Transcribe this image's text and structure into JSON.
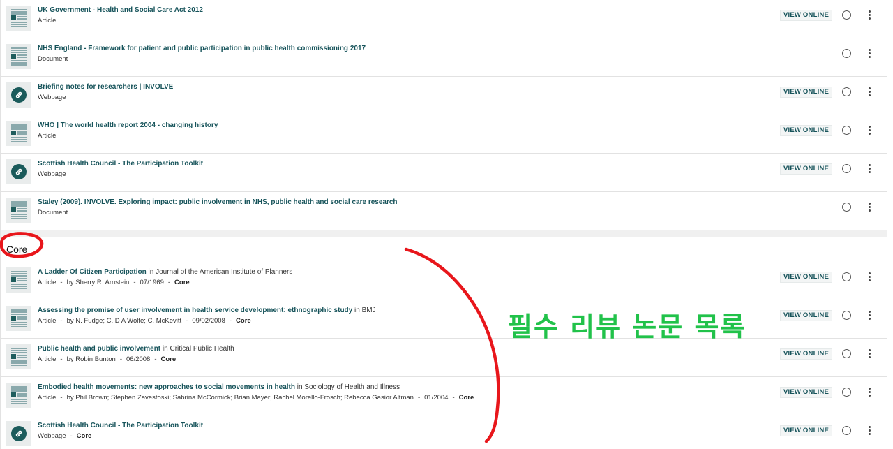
{
  "view_online_label": "VIEW ONLINE",
  "colors": {
    "title": "#16535a",
    "annotation_red": "#e8161b",
    "annotation_green": "#21c24a"
  },
  "top_items": [
    {
      "title": "UK Government - Health and Social Care Act 2012",
      "type": "Article",
      "icon": "document-icon",
      "view_online": true
    },
    {
      "title": "NHS England - Framework for patient and public participation in public health commissioning 2017",
      "type": "Document",
      "icon": "document-icon",
      "view_online": false
    },
    {
      "title": "Briefing notes for researchers | INVOLVE",
      "type": "Webpage",
      "icon": "link-icon",
      "view_online": true
    },
    {
      "title": "WHO | The world health report 2004 - changing history",
      "type": "Article",
      "icon": "document-icon",
      "view_online": true
    },
    {
      "title": "Scottish Health Council - The Participation Toolkit",
      "type": "Webpage",
      "icon": "link-icon",
      "view_online": true
    },
    {
      "title": "Staley (2009). INVOLVE. Exploring impact: public involvement in NHS, public health and social care research",
      "type": "Document",
      "icon": "document-icon",
      "view_online": false
    }
  ],
  "section": {
    "label": "Core"
  },
  "core_items": [
    {
      "title": "A Ladder Of Citizen Participation",
      "source": " in Journal of the American Institute of Planners",
      "type": "Article",
      "authors": "by Sherry R. Arnstein",
      "date": "07/1969",
      "tag": "Core",
      "icon": "document-icon",
      "view_online": true
    },
    {
      "title": "Assessing the promise of user involvement in health service development: ethnographic study",
      "source": " in BMJ",
      "type": "Article",
      "authors": "by N. Fudge; C. D A Wolfe; C. McKevitt",
      "date": "09/02/2008",
      "tag": "Core",
      "icon": "document-icon",
      "view_online": true
    },
    {
      "title": "Public health and public involvement",
      "source": " in Critical Public Health",
      "type": "Article",
      "authors": "by Robin Bunton",
      "date": "06/2008",
      "tag": "Core",
      "icon": "document-icon",
      "view_online": true
    },
    {
      "title": "Embodied health movements: new approaches to social movements in health",
      "source": " in Sociology of Health and Illness",
      "type": "Article",
      "authors": "by Phil Brown; Stephen Zavestoski; Sabrina McCormick; Brian Mayer; Rachel Morello-Frosch; Rebecca Gasior Altman",
      "date": "01/2004",
      "tag": "Core",
      "icon": "document-icon",
      "view_online": true
    },
    {
      "title": "Scottish Health Council - The Participation Toolkit",
      "source": "",
      "type": "Webpage",
      "authors": "",
      "date": "",
      "tag": "Core",
      "icon": "link-icon",
      "view_online": true
    }
  ],
  "annotation": {
    "text": "필수 리뷰 논문 목록"
  }
}
